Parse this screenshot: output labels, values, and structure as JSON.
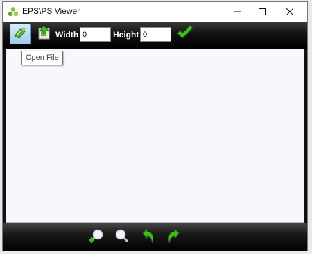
{
  "window": {
    "title": "EPS\\PS Viewer",
    "icon": "app-logo-icon"
  },
  "title_buttons": {
    "minimize": "minimize-icon",
    "maximize": "maximize-icon",
    "close": "close-icon"
  },
  "toolbar": {
    "open_icon": "open-file-icon",
    "save_icon": "save-icon",
    "width_label": "Width",
    "width_value": "0",
    "height_label": "Height",
    "height_value": "0",
    "apply_icon": "checkmark-icon"
  },
  "tooltip": {
    "text": "Open File"
  },
  "bottombar": {
    "zoom_in": "zoom-in-icon",
    "zoom_out": "zoom-out-icon",
    "rotate_left": "rotate-left-icon",
    "rotate_right": "rotate-right-icon"
  },
  "colors": {
    "toolbar_bg": "#000000",
    "canvas_bg": "#f7f8fc",
    "accent_green": "#3fbf1f"
  }
}
